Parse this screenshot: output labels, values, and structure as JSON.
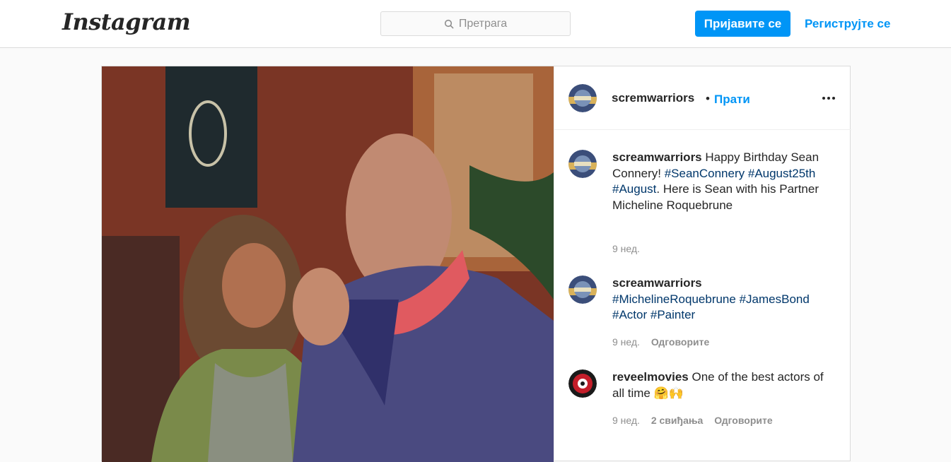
{
  "header": {
    "logo": "Instagram",
    "search_placeholder": "Претрага",
    "login_label": "Пријавите се",
    "signup_label": "Региструјте се"
  },
  "post": {
    "username": "scremwarriors",
    "follow_label": "Прати"
  },
  "comments": [
    {
      "user": "screamwarriors",
      "text_1": " Happy Birthday Sean Connery! ",
      "tag_1": "#SeanConnery",
      "tag_2": "#August25th",
      "tag_3": "#August",
      "text_2": ". Here is Sean with his Partner Micheline Roquebrune",
      "time": "9 нед."
    },
    {
      "user": "screamwarriors",
      "tag_1": "#MichelineRoquebrune",
      "tag_2": "#JamesBond",
      "tag_3": "#Actor",
      "tag_4": "#Painter",
      "time": "9 нед.",
      "reply": "Одговорите"
    },
    {
      "user": "reveelmovies",
      "text_1": " One of the best actors of all time ",
      "emoji": "🤗🙌",
      "time": "9 нед.",
      "likes": "2 свиђања",
      "reply": "Одговорите"
    }
  ],
  "icons": {
    "search": "search-icon",
    "more": "more-options-icon",
    "avatar_1": "scream-warriors-avatar",
    "avatar_2": "reveel-movies-avatar"
  },
  "colors": {
    "accent": "#0095f6",
    "hashtag": "#00376b",
    "muted": "#8e8e8e",
    "border": "#dbdbdb"
  }
}
